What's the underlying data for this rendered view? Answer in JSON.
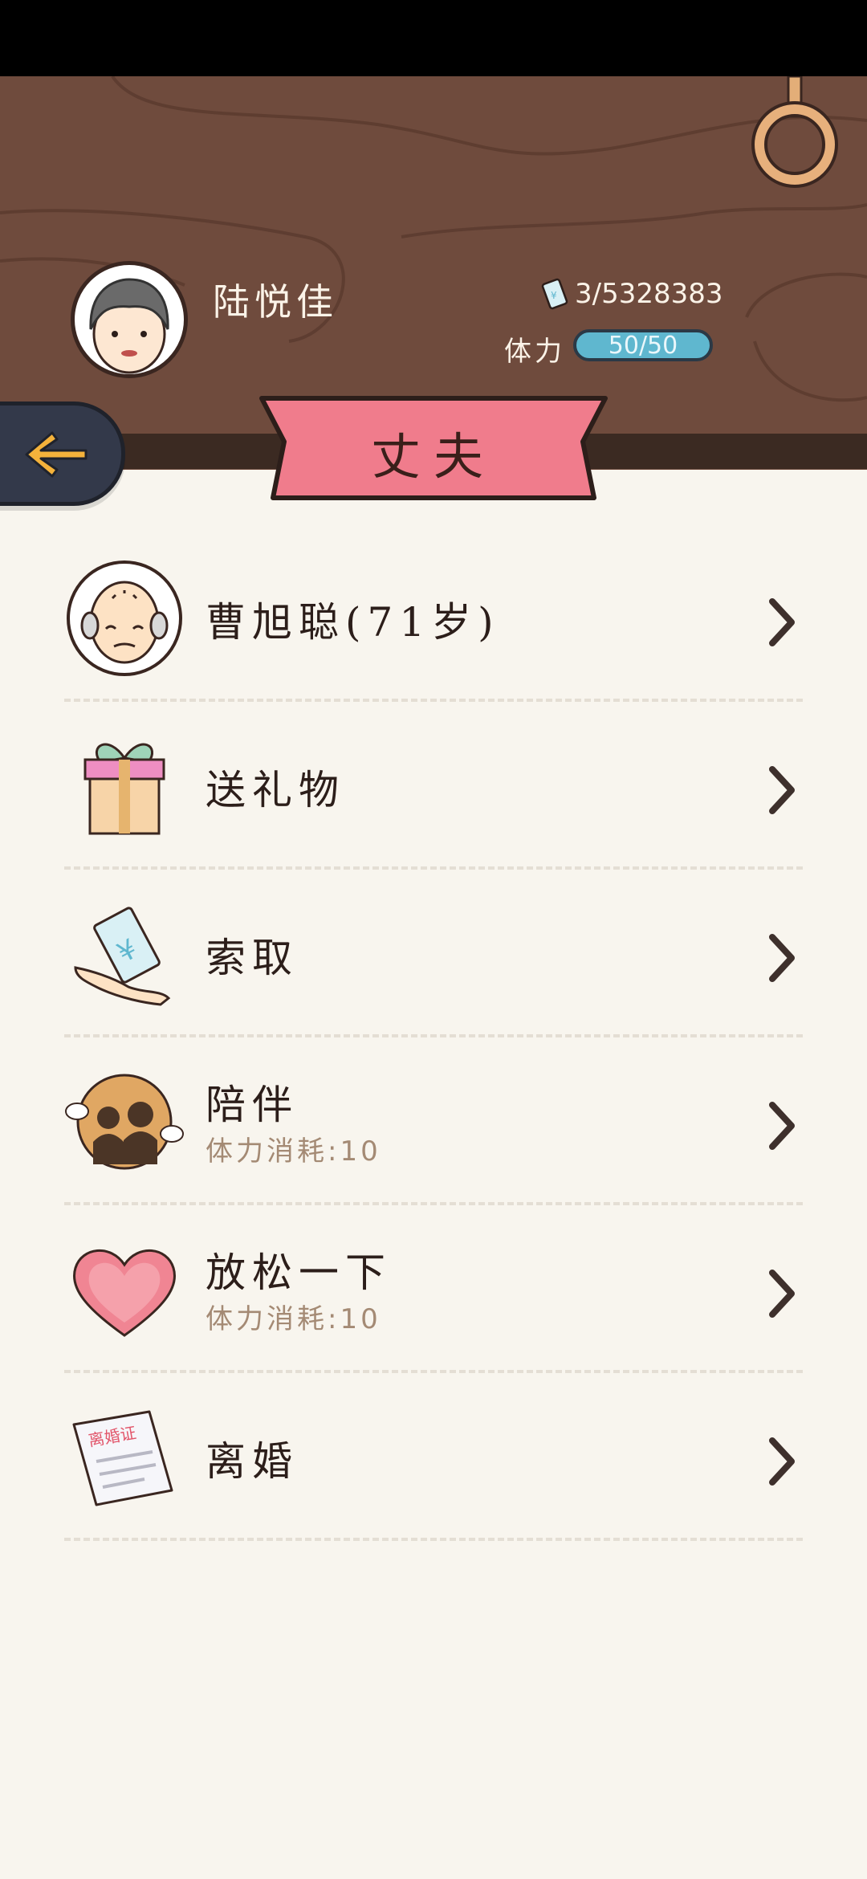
{
  "header": {
    "player_name": "陆悦佳",
    "money": "3/5328383",
    "stamina_label": "体力",
    "stamina_value": "50/50",
    "title": "丈夫"
  },
  "menu": {
    "items": [
      {
        "title": "曹旭聪(71岁)",
        "subtitle": "",
        "icon": "elderly-husband-avatar"
      },
      {
        "title": "送礼物",
        "subtitle": "",
        "icon": "gift-icon"
      },
      {
        "title": "索取",
        "subtitle": "",
        "icon": "money-hand-icon"
      },
      {
        "title": "陪伴",
        "subtitle": "体力消耗:10",
        "icon": "companion-icon"
      },
      {
        "title": "放松一下",
        "subtitle": "体力消耗:10",
        "icon": "heart-icon"
      },
      {
        "title": "离婚",
        "subtitle": "",
        "icon": "divorce-certificate-icon",
        "certificate_text": "离婚证"
      }
    ]
  },
  "colors": {
    "header_wood": "#6f4b3d",
    "ribbon": "#f07c8c",
    "stamina_bar": "#5fb7cf",
    "back_button": "#33394a",
    "arrow": "#f4b23b",
    "background": "#f8f5ee"
  }
}
